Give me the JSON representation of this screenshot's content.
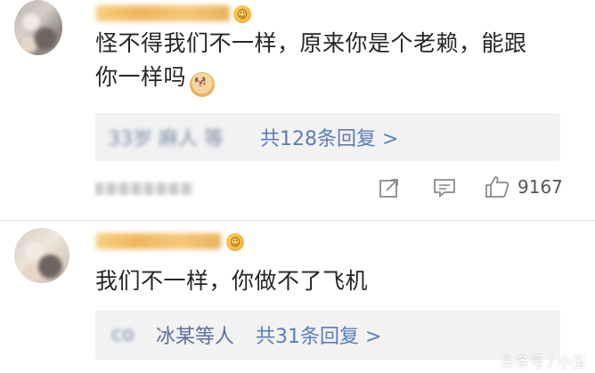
{
  "comments": [
    {
      "text_line1": "怪不得我们不一样，原来你是个老赖，能跟",
      "text_line2": "你一样吗",
      "emoji": "doge-emoji",
      "replies": {
        "names_blurred": "33岁 麻人 等",
        "link": "共128条回复 >"
      },
      "actions": {
        "share_icon": "share-icon",
        "comment_icon": "comment-icon",
        "like_icon": "thumbs-up-icon",
        "like_count": "9167"
      }
    },
    {
      "text": "我们不一样，你做不了飞机",
      "replies": {
        "names_blurred": "co",
        "names_clear": "冰某等人",
        "link": "共31条回复 >"
      }
    }
  ],
  "watermark": "头条号 / 小玉"
}
